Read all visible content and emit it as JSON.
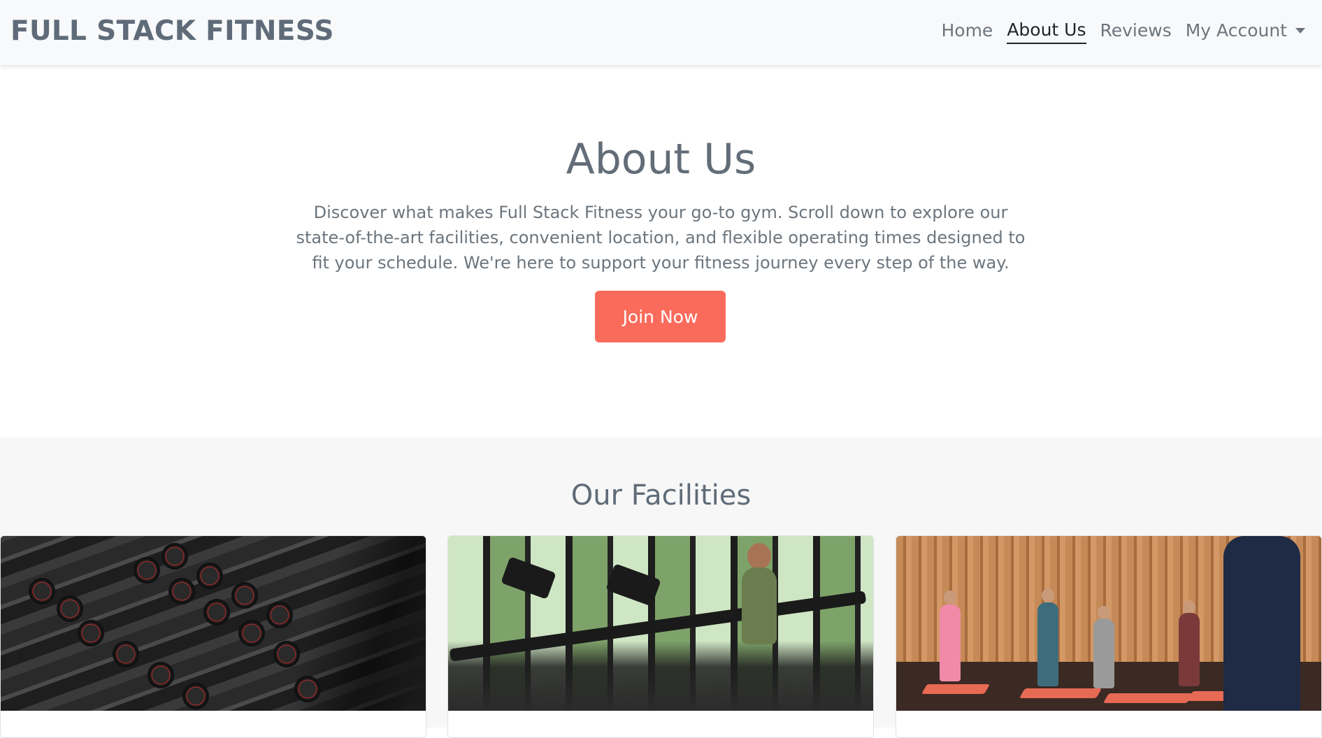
{
  "navbar": {
    "brand": "FULL STACK FITNESS",
    "links": [
      {
        "label": "Home"
      },
      {
        "label": "About Us"
      },
      {
        "label": "Reviews"
      },
      {
        "label": "My Account"
      }
    ]
  },
  "hero": {
    "title": "About Us",
    "description": "Discover what makes Full Stack Fitness your go-to gym. Scroll down to explore our state-of-the-art facilities, convenient location, and flexible operating times designed to fit your schedule. We're here to support your fitness journey every step of the way.",
    "button_label": "Join Now"
  },
  "facilities": {
    "heading": "Our Facilities"
  },
  "colors": {
    "accent": "#fa6b5c",
    "navbar_bg": "#f8f9fa",
    "text_muted": "#6c757d"
  }
}
